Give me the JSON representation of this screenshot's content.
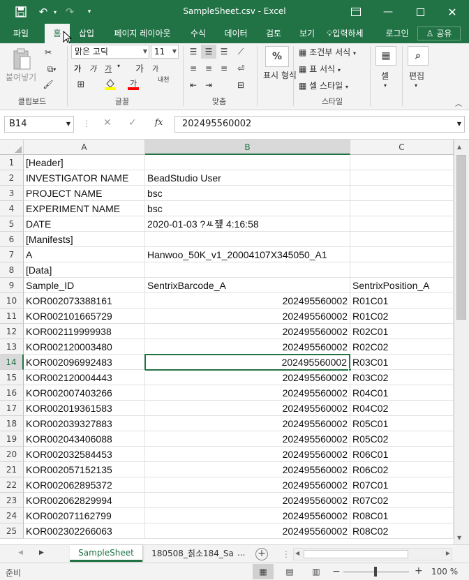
{
  "titlebar": {
    "title": "SampleSheet.csv  -  Excel",
    "accent": "#217346"
  },
  "tabs": [
    "파일",
    "홈",
    "삽입",
    "페이지 레이아웃",
    "수식",
    "데이터",
    "검토",
    "보기"
  ],
  "tell_me": "입력하세",
  "signin": "로그인",
  "share": "공유",
  "ribbon": {
    "clipboard": {
      "paste": "붙여넣기",
      "label": "클립보드"
    },
    "font": {
      "name": "맑은 고딕",
      "size": "11",
      "label": "글꼴",
      "bold": "가",
      "italic": "가",
      "underline": "가",
      "grow": "가",
      "shrink": "가",
      "phonetic": "내천"
    },
    "alignment": {
      "label": "맞춤"
    },
    "number": {
      "format_label": "표시 형식",
      "percent": "%"
    },
    "styles": {
      "conditional": "조건부 서식",
      "table": "표 서식",
      "cell": "셀 스타일",
      "label": "스타일"
    },
    "cells": {
      "label": "셀"
    },
    "editing": {
      "label": "편집"
    }
  },
  "formula_bar": {
    "name_box": "B14",
    "fx": "fx",
    "value": "202495560002"
  },
  "columns": [
    "A",
    "B",
    "C"
  ],
  "selected_column": "B",
  "selected_row": 14,
  "rows": [
    {
      "n": "1",
      "a": "[Header]",
      "b": "",
      "b_num": false,
      "c": ""
    },
    {
      "n": "2",
      "a": "INVESTIGATOR NAME",
      "b": "BeadStudio User",
      "b_num": false,
      "c": ""
    },
    {
      "n": "3",
      "a": "PROJECT NAME",
      "b": "bsc",
      "b_num": false,
      "c": ""
    },
    {
      "n": "4",
      "a": "EXPERIMENT NAME",
      "b": "bsc",
      "b_num": false,
      "c": ""
    },
    {
      "n": "5",
      "a": "DATE",
      "b": "2020-01-03 ?ㅻ쟾 4:16:58",
      "b_num": false,
      "c": ""
    },
    {
      "n": "6",
      "a": "[Manifests]",
      "b": "",
      "b_num": false,
      "c": ""
    },
    {
      "n": "7",
      "a": "A",
      "b": "Hanwoo_50K_v1_20004107X345050_A1",
      "b_num": false,
      "c": ""
    },
    {
      "n": "8",
      "a": "[Data]",
      "b": "",
      "b_num": false,
      "c": ""
    },
    {
      "n": "9",
      "a": "Sample_ID",
      "b": "SentrixBarcode_A",
      "b_num": false,
      "c": "SentrixPosition_A"
    },
    {
      "n": "10",
      "a": "KOR002073388161",
      "b": "202495560002",
      "b_num": true,
      "c": "R01C01"
    },
    {
      "n": "11",
      "a": "KOR002101665729",
      "b": "202495560002",
      "b_num": true,
      "c": "R01C02"
    },
    {
      "n": "12",
      "a": "KOR002119999938",
      "b": "202495560002",
      "b_num": true,
      "c": "R02C01"
    },
    {
      "n": "13",
      "a": "KOR002120003480",
      "b": "202495560002",
      "b_num": true,
      "c": "R02C02"
    },
    {
      "n": "14",
      "a": "KOR002096992483",
      "b": "202495560002",
      "b_num": true,
      "c": "R03C01"
    },
    {
      "n": "15",
      "a": "KOR002120004443",
      "b": "202495560002",
      "b_num": true,
      "c": "R03C02"
    },
    {
      "n": "16",
      "a": "KOR002007403266",
      "b": "202495560002",
      "b_num": true,
      "c": "R04C01"
    },
    {
      "n": "17",
      "a": "KOR002019361583",
      "b": "202495560002",
      "b_num": true,
      "c": "R04C02"
    },
    {
      "n": "18",
      "a": "KOR002039327883",
      "b": "202495560002",
      "b_num": true,
      "c": "R05C01"
    },
    {
      "n": "19",
      "a": "KOR002043406088",
      "b": "202495560002",
      "b_num": true,
      "c": "R05C02"
    },
    {
      "n": "20",
      "a": "KOR002032584453",
      "b": "202495560002",
      "b_num": true,
      "c": "R06C01"
    },
    {
      "n": "21",
      "a": "KOR002057152135",
      "b": "202495560002",
      "b_num": true,
      "c": "R06C02"
    },
    {
      "n": "22",
      "a": "KOR002062895372",
      "b": "202495560002",
      "b_num": true,
      "c": "R07C01"
    },
    {
      "n": "23",
      "a": "KOR002062829994",
      "b": "202495560002",
      "b_num": true,
      "c": "R07C02"
    },
    {
      "n": "24",
      "a": "KOR002071162799",
      "b": "202495560002",
      "b_num": true,
      "c": "R08C01"
    },
    {
      "n": "25",
      "a": "KOR002302266063",
      "b": "202495560002",
      "b_num": true,
      "c": "R08C02"
    }
  ],
  "sheets": [
    "SampleSheet",
    "180508_칡소184_Sa"
  ],
  "sheet_more": "...",
  "status": {
    "ready": "준비",
    "zoom": "100 %"
  }
}
